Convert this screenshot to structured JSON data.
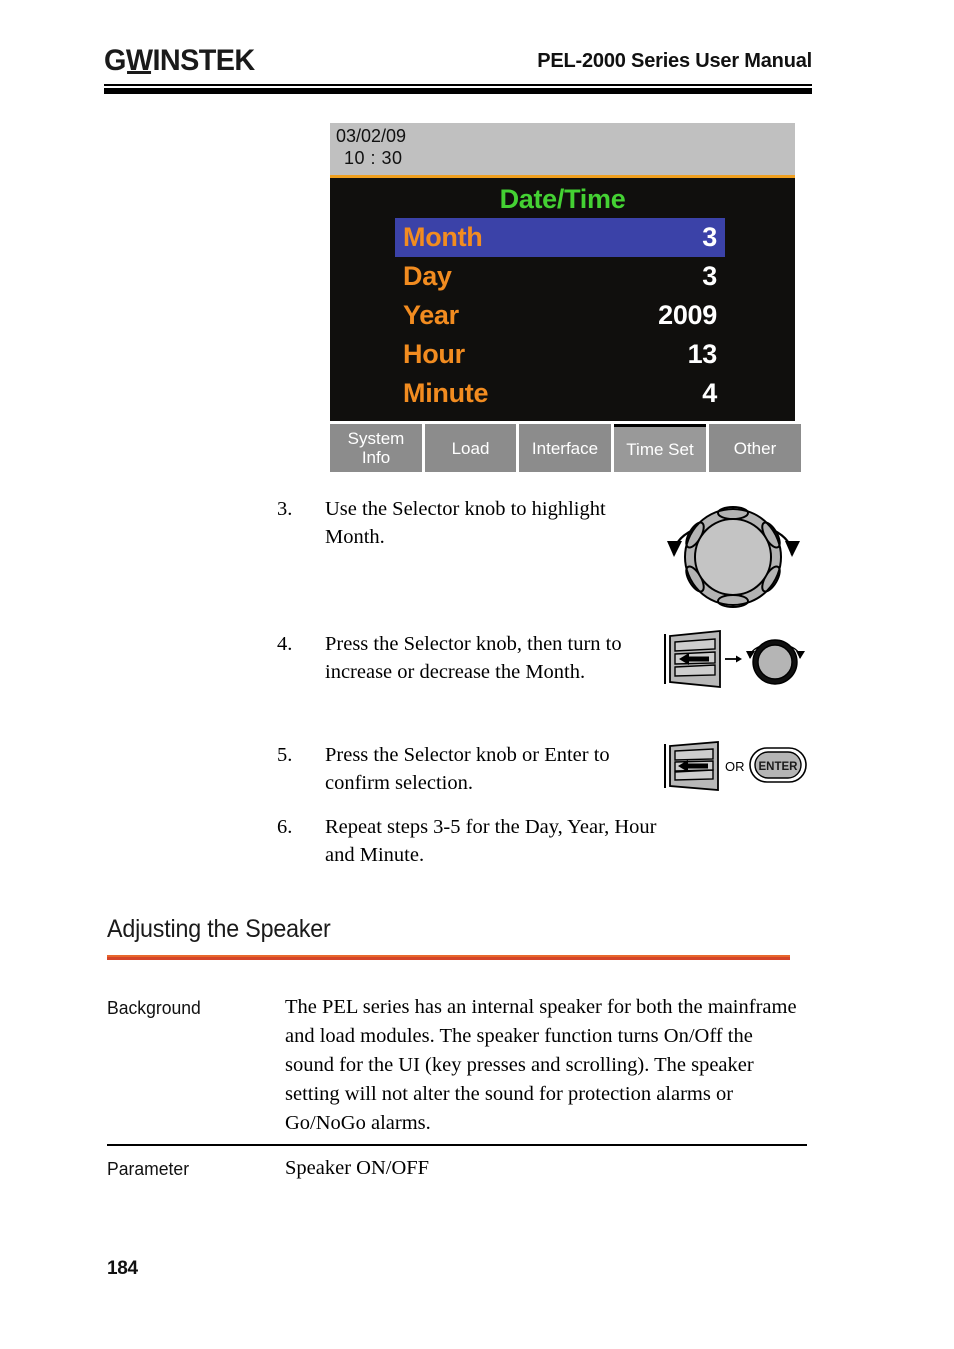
{
  "header": {
    "logo_gw": "G",
    "logo_w": "W",
    "logo_instek": "INSTEK",
    "manual_title": "PEL-2000 Series User Manual"
  },
  "lcd": {
    "status_date": "03/02/09",
    "status_time": "10 : 30",
    "screen_title": "Date/Time",
    "menu": [
      {
        "label": "Month",
        "value": "3",
        "selected": true
      },
      {
        "label": "Day",
        "value": "3",
        "selected": false
      },
      {
        "label": "Year",
        "value": "2009",
        "selected": false
      },
      {
        "label": "Hour",
        "value": "13",
        "selected": false
      },
      {
        "label": "Minute",
        "value": "4",
        "selected": false
      }
    ],
    "tabs": [
      {
        "label": "System Info",
        "line1": "System",
        "line2": "Info",
        "active": false
      },
      {
        "label": "Load",
        "line1": "Load",
        "line2": "",
        "active": false
      },
      {
        "label": "Interface",
        "line1": "Interface",
        "line2": "",
        "active": false
      },
      {
        "label": "Time Set",
        "line1": "Time Set",
        "line2": "",
        "active": true
      },
      {
        "label": "Other",
        "line1": "Other",
        "line2": "",
        "active": false
      }
    ],
    "colors": {
      "background": "#100f0d",
      "status_bar": "#c0c0c0",
      "separator": "#f0a020",
      "title": "#44d133",
      "label": "#f28c20",
      "value": "#ffffff",
      "highlight": "#3b42a8",
      "tab": "#8c8c8c",
      "tab_active": "#999999"
    }
  },
  "steps": [
    {
      "num": "3.",
      "text": "Use the Selector knob to highlight Month."
    },
    {
      "num": "4.",
      "text": "Press the Selector knob, then turn to increase or decrease the Month."
    },
    {
      "num": "5.",
      "text": "Press the Selector knob or Enter to confirm selection."
    },
    {
      "num": "6.",
      "text": "Repeat steps 3-5 for the Day, Year, Hour and Minute."
    }
  ],
  "figures": {
    "enter_button_label": "ENTER",
    "or_label": "OR"
  },
  "section": {
    "heading": "Adjusting the Speaker",
    "rule_color": "#e8672c",
    "rows": [
      {
        "term": "Background",
        "desc": "The PEL series has an internal speaker for both the mainframe and load modules. The speaker function turns On/Off the sound for the UI (key presses and scrolling). The speaker setting will not alter the sound for protection alarms or Go/NoGo alarms."
      },
      {
        "term": "Parameter",
        "desc": "Speaker   ON/OFF"
      }
    ]
  },
  "footer": {
    "page_number": "184"
  }
}
